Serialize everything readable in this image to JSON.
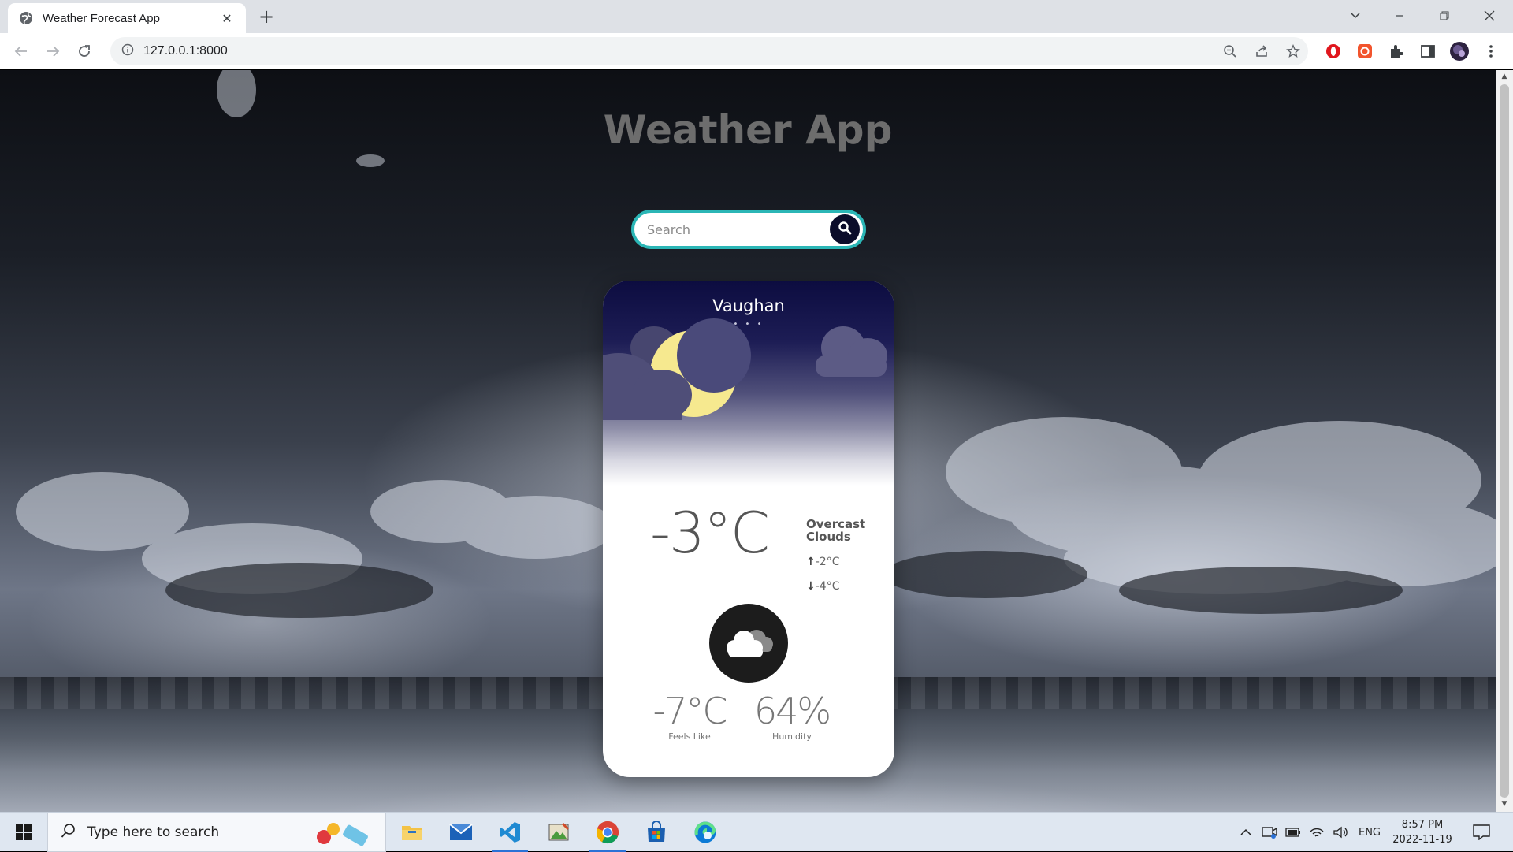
{
  "browser": {
    "tab_title": "Weather Forecast App",
    "tab_close": "✕",
    "new_tab": "+",
    "url": "127.0.0.1:8000"
  },
  "page": {
    "title": "Weather App",
    "search": {
      "placeholder": "Search",
      "value": ""
    },
    "card": {
      "city": "Vaughan",
      "dots": "• • •",
      "temperature": "-3°C",
      "condition_line1": "Overcast",
      "condition_line2": "Clouds",
      "high": "-2°C",
      "low": "-4°C",
      "high_arrow": "↑",
      "low_arrow": "↓",
      "feels_like_value": "-7°C",
      "feels_like_label": "Feels Like",
      "humidity_value": "64%",
      "humidity_label": "Humidity"
    }
  },
  "taskbar": {
    "search_placeholder": "Type here to search",
    "language": "ENG",
    "time": "8:57 PM",
    "date": "2022-11-19"
  },
  "colors": {
    "search_border": "#2bb6b6",
    "search_button": "#0b0c2a",
    "card_sky_top": "#0c0c40",
    "moon": "#f6e98f",
    "title": "#6d6d6d"
  },
  "icons": [
    "globe-icon",
    "back-arrow-icon",
    "forward-arrow-icon",
    "reload-icon",
    "info-icon",
    "zoom-icon",
    "share-icon",
    "star-icon",
    "opera-icon",
    "screenshot-icon",
    "extensions-icon",
    "sidepanel-icon",
    "profile-avatar",
    "menu-icon",
    "magnifier-icon",
    "moon-icon",
    "cloud-icon",
    "windows-start-icon",
    "file-explorer-icon",
    "mail-icon",
    "vscode-icon",
    "image-editor-icon",
    "chrome-icon",
    "store-icon",
    "edge-icon",
    "notification-icon"
  ]
}
